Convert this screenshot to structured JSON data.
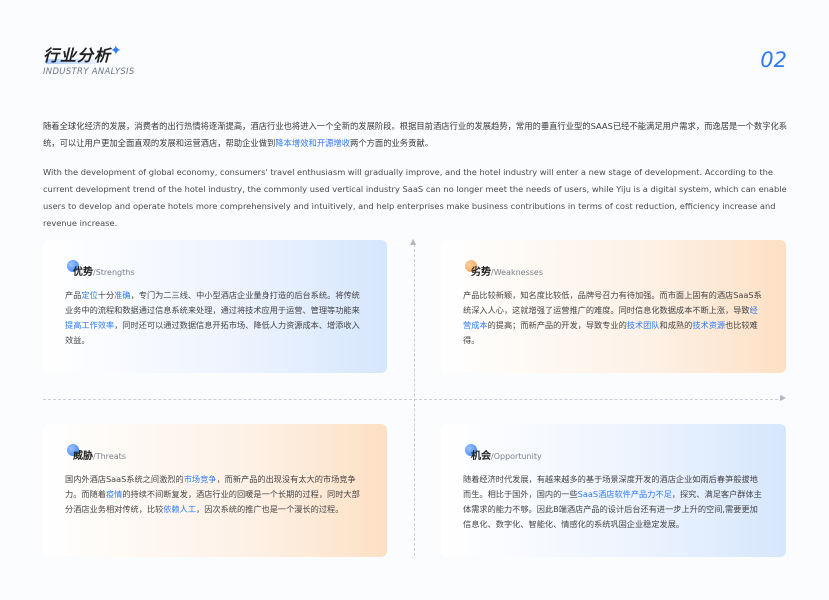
{
  "header": {
    "title_zh": "行业分析",
    "title_en": "INDUSTRY ANALYSIS",
    "star_icon": "sparkle-icon",
    "page_number": "02"
  },
  "intro": {
    "zh_before": "随着全球化经济的发展，消费者的出行热情将逐渐提高，酒店行业也将进入一个全新的发展阶段。根据目前酒店行业的发展趋势，常用的垂直行业型的SAAS已经不能满足用户需求，而逸居是一个数字化系统，可以让用户更加全面直观的发展和运营酒店，帮助企业做到",
    "zh_highlight": "降本增效和开源增收",
    "zh_after": "两个方面的业务贡献。",
    "en": "With the development of global economy, consumers' travel enthusiasm will gradually improve, and the hotel industry will enter a new stage of development. According to the current development trend of the hotel industry, the commonly used vertical industry SaaS can no longer meet the needs of users, while Yiju is a digital system, which can enable users to develop and operate hotels more comprehensively and intuitively, and help enterprises make business contributions in terms of cost reduction, efficiency increase and revenue increase."
  },
  "swot": {
    "strengths": {
      "title_zh": "优势",
      "title_en": "/Strengths",
      "segments": [
        {
          "text": "产品",
          "hl": false
        },
        {
          "text": "定位",
          "hl": true
        },
        {
          "text": "十分",
          "hl": false
        },
        {
          "text": "准确",
          "hl": true
        },
        {
          "text": "，专门为二三线、中小型酒店企业量身打造的后台系统。将传统业务中的流程和数据通过信息系统来处理，通过将技术应用于运营、管理等功能来",
          "hl": false
        },
        {
          "text": "提高工作效率",
          "hl": true
        },
        {
          "text": "，同时还可以通过数据信息开拓市场、降低人力资源成本、增添收入效益。",
          "hl": false
        }
      ]
    },
    "weaknesses": {
      "title_zh": "劣势",
      "title_en": "/Weaknesses",
      "segments": [
        {
          "text": "产品比较新颖，知名度比较低，品牌号召力有待加强。而市面上固有的酒店SaaS系统深入人心，这就增强了运营推广的难度。同时信息化数据成本不断上涨，导致",
          "hl": false
        },
        {
          "text": "经营成本",
          "hl": true
        },
        {
          "text": "的提高；而新产品的开发，导致专业的",
          "hl": false
        },
        {
          "text": "技术团队",
          "hl": true
        },
        {
          "text": "和成熟的",
          "hl": false
        },
        {
          "text": "技术资源",
          "hl": true
        },
        {
          "text": "也比较难得。",
          "hl": false
        }
      ]
    },
    "threats": {
      "title_zh": "威胁",
      "title_en": "/Threats",
      "segments": [
        {
          "text": "国内外酒店SaaS系统之间激烈的",
          "hl": false
        },
        {
          "text": "市场竞争",
          "hl": true
        },
        {
          "text": "，而新产品的出现没有太大的市场竞争力。而随着",
          "hl": false
        },
        {
          "text": "疫情",
          "hl": true
        },
        {
          "text": "的持续不间断复发，酒店行业的回暖是一个长期的过程，同时大部分酒店业务相对传统，比较",
          "hl": false
        },
        {
          "text": "依赖人工",
          "hl": true
        },
        {
          "text": "，因次系统的推广也是一个漫长的过程。",
          "hl": false
        }
      ]
    },
    "opportunity": {
      "title_zh": "机会",
      "title_en": "/Opportunity",
      "segments": [
        {
          "text": "随着经济时代发展，有越来越多的基于场景深度开发的酒店企业如雨后春笋般拔地而生。相比于国外，国内的一些",
          "hl": false
        },
        {
          "text": "SaaS酒店软件产品力不足",
          "hl": true
        },
        {
          "text": "，探究、满足客户群体主体需求的能力不够。因此B端酒店产品的设计后台还有进一步上升的空间,需要更加信息化、数字化、智能化、情感化的系统巩固企业稳定发展。",
          "hl": false
        }
      ]
    }
  },
  "colors": {
    "accent": "#2f7bf2",
    "warm": "#f29a45"
  }
}
